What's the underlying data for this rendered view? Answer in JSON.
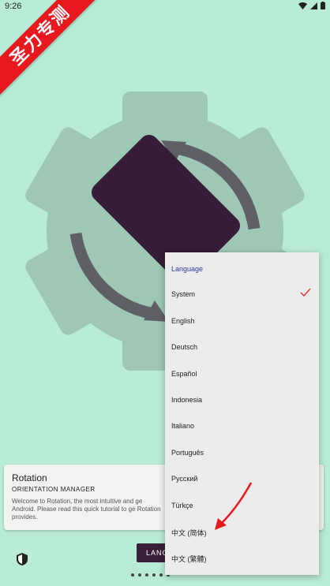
{
  "status_bar": {
    "time": "9:26",
    "icons": [
      "wifi-icon",
      "signal-icon",
      "battery-icon"
    ]
  },
  "ribbon": {
    "text": "圣力专测",
    "color": "#e8191e"
  },
  "hero": {
    "icon": "rotation-gear-icon",
    "colors": {
      "gear": "#9ec7b5",
      "phone": "#361c36",
      "arrows": "#5f6066",
      "background": "#b8ecd6"
    }
  },
  "card": {
    "title": "Rotation",
    "subtitle": "ORIENTATION MANAGER",
    "description": "Welcome to Rotation, the most intuitive and ge Android. Please read this quick tutorial to ge Rotation provides."
  },
  "bottom_bar": {
    "shield_icon": "shield-icon",
    "language_button": "LANG",
    "page_count": 6
  },
  "language_menu": {
    "header": "Language",
    "items": [
      {
        "label": "System",
        "selected": true
      },
      {
        "label": "English",
        "selected": false
      },
      {
        "label": "Deutsch",
        "selected": false
      },
      {
        "label": "Español",
        "selected": false
      },
      {
        "label": "Indonesia",
        "selected": false
      },
      {
        "label": "Italiano",
        "selected": false
      },
      {
        "label": "Português",
        "selected": false
      },
      {
        "label": "Русский",
        "selected": false
      },
      {
        "label": "Türkçe",
        "selected": false
      },
      {
        "label": "中文 (简体)",
        "selected": false
      },
      {
        "label": "中文 (繁體)",
        "selected": false
      }
    ],
    "check_color": "#e53935",
    "header_color": "#2f3a9e"
  },
  "annotation": {
    "type": "arrow",
    "color": "#e8191e",
    "points_to": "中文 (简体)"
  }
}
